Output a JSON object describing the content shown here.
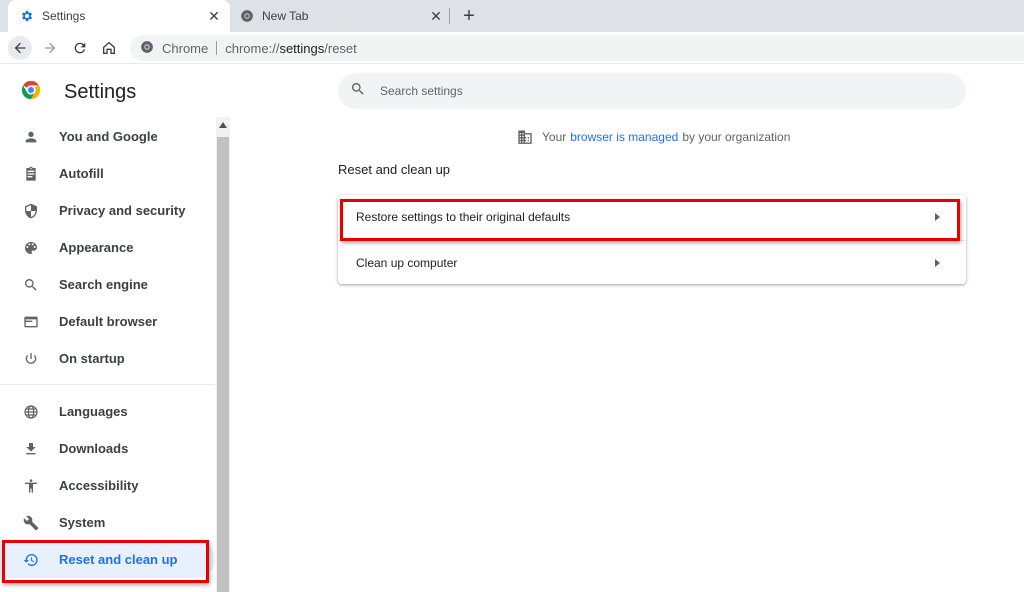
{
  "browser": {
    "tabs": [
      {
        "title": "Settings",
        "icon": "gear-icon",
        "active": true
      },
      {
        "title": "New Tab",
        "icon": "chrome-icon",
        "active": false
      }
    ],
    "new_tab_label": "+",
    "close_glyph": "✕",
    "omnibox": {
      "chip": "Chrome",
      "url_prefix": "chrome://",
      "url_host": "settings",
      "url_path": "/reset"
    }
  },
  "sidebar": {
    "title": "Settings",
    "items": [
      {
        "label": "You and Google",
        "icon": "person-icon"
      },
      {
        "label": "Autofill",
        "icon": "clipboard-icon"
      },
      {
        "label": "Privacy and security",
        "icon": "shield-icon"
      },
      {
        "label": "Appearance",
        "icon": "palette-icon"
      },
      {
        "label": "Search engine",
        "icon": "search-icon"
      },
      {
        "label": "Default browser",
        "icon": "browser-window-icon"
      },
      {
        "label": "On startup",
        "icon": "power-icon"
      },
      {
        "label": "Languages",
        "icon": "globe-icon"
      },
      {
        "label": "Downloads",
        "icon": "download-icon"
      },
      {
        "label": "Accessibility",
        "icon": "accessibility-icon"
      },
      {
        "label": "System",
        "icon": "wrench-icon"
      },
      {
        "label": "Reset and clean up",
        "icon": "reset-history-icon",
        "selected": true
      }
    ]
  },
  "main": {
    "search_placeholder": "Search settings",
    "managed_notice": {
      "prefix": "Your",
      "link": "browser is managed",
      "suffix": "by your organization"
    },
    "section_title": "Reset and clean up",
    "rows": [
      {
        "label": "Restore settings to their original defaults",
        "highlighted": true
      },
      {
        "label": "Clean up computer",
        "highlighted": false
      }
    ]
  },
  "colors": {
    "accent": "#1a73e8",
    "highlight_box": "#e60000",
    "selected_bg": "#e8f0fe"
  }
}
